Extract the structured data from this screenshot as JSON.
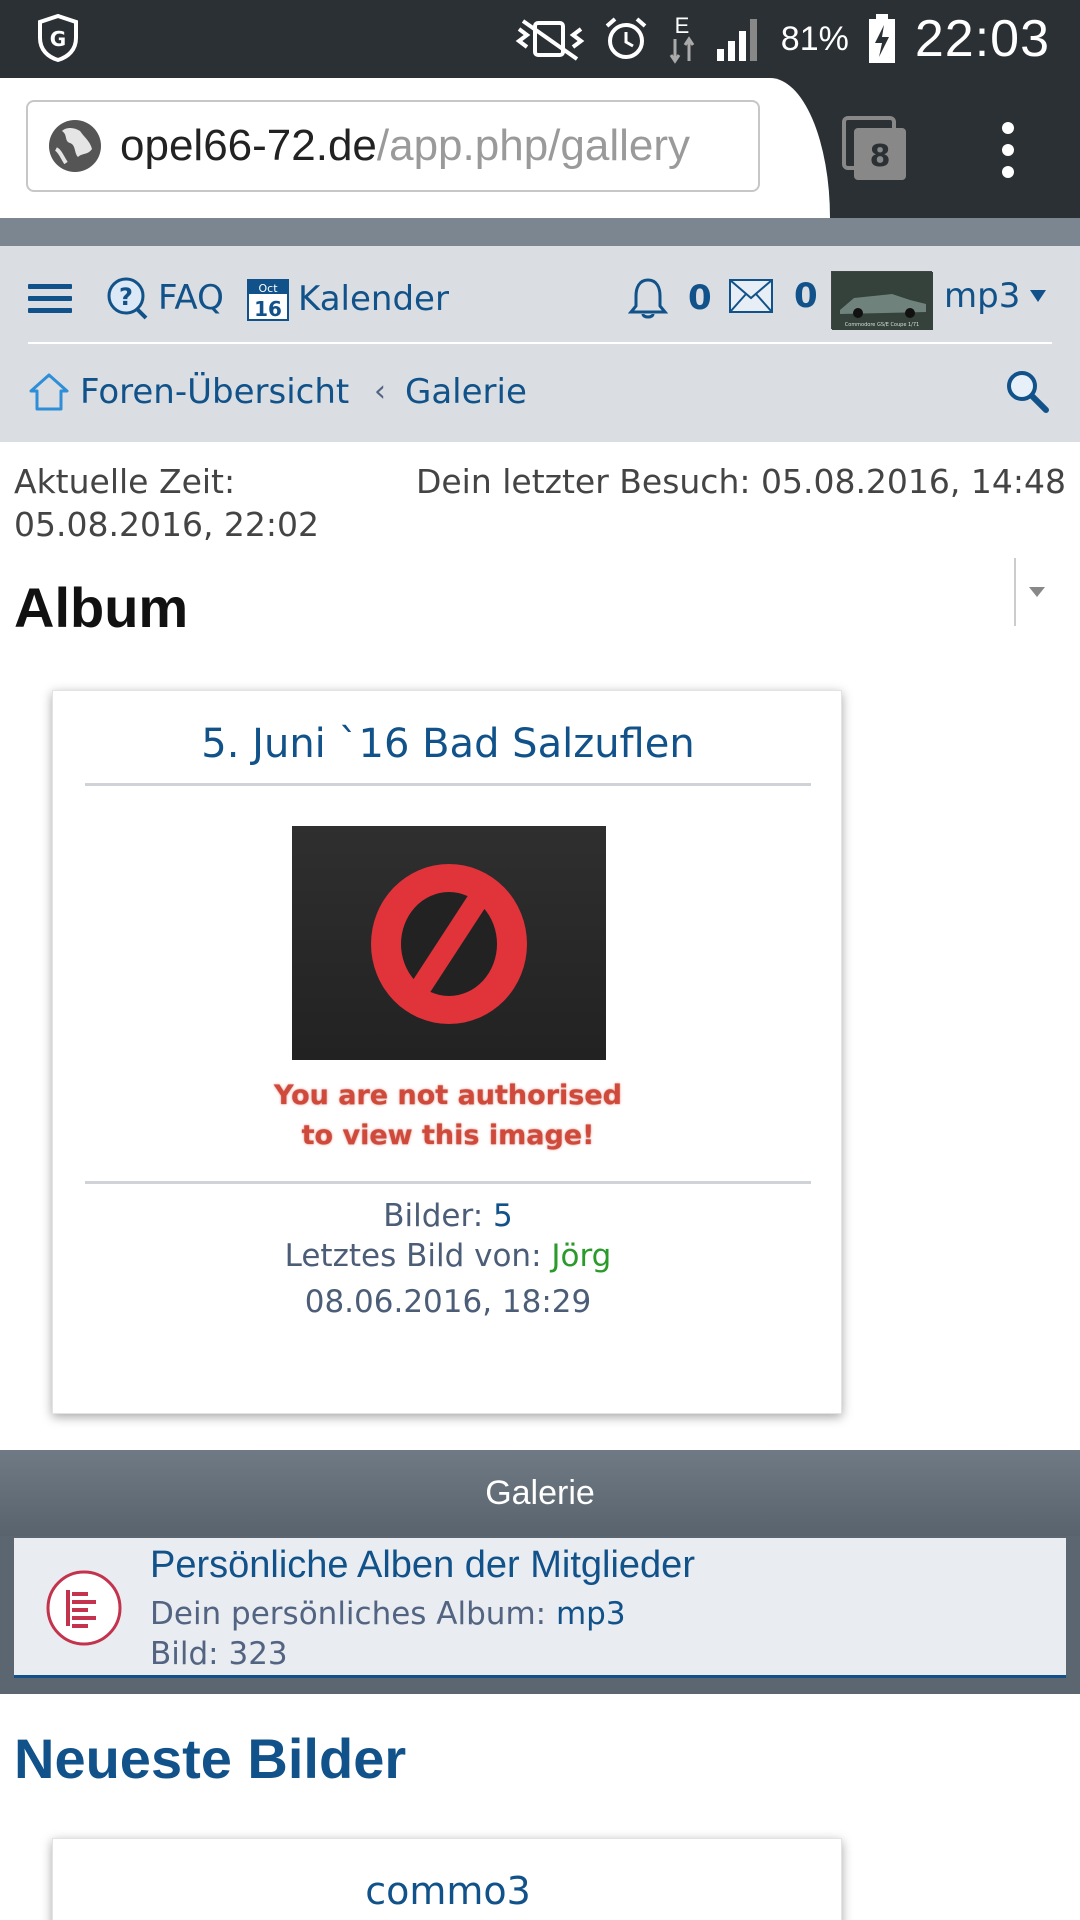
{
  "statusbar": {
    "battery": "81%",
    "time": "22:03",
    "network": "E"
  },
  "browser": {
    "url_domain": "opel66-72.de",
    "url_path": "/app.php/gallery",
    "tab_count": "8"
  },
  "nav": {
    "faq": "FAQ",
    "calendar_icon_top": "Oct",
    "calendar_icon_day": "16",
    "calendar": "Kalender",
    "notifications_count": "0",
    "messages_count": "0",
    "username": "mp3",
    "avatar_caption": "Commodore GS/E Coupe 1/71"
  },
  "breadcrumb": {
    "home": "Foren-Übersicht",
    "separator": "‹",
    "current": "Galerie"
  },
  "info": {
    "current_time_label": "Aktuelle Zeit:",
    "current_time_value": "05.08.2016, 22:02",
    "last_visit": "Dein letzter Besuch: 05.08.2016, 14:48"
  },
  "album": {
    "heading": "Album",
    "card": {
      "title": "5. Juni `16 Bad Salzuflen",
      "noimage_line1": "You are not authorised",
      "noimage_line2": "to view this image!",
      "images_label": "Bilder: ",
      "images_value": "5",
      "last_image_label": "Letztes Bild von: ",
      "last_image_user": "Jörg",
      "date": "08.06.2016, 18:29"
    }
  },
  "gallery_section": {
    "header": "Galerie",
    "row_title": "Persönliche Alben der Mitglieder",
    "personal_album_label": "Dein persönliches Album: ",
    "personal_album_value": "mp3",
    "picture_label": "Bild: ",
    "picture_value": "323"
  },
  "newest": {
    "heading": "Neueste Bilder",
    "first_title": "commo3"
  },
  "colors": {
    "link": "#105289",
    "nav_bg": "#dadde1",
    "section_header": "#5b6670",
    "username_green": "#2a9a2a",
    "error_red": "#e53935"
  }
}
